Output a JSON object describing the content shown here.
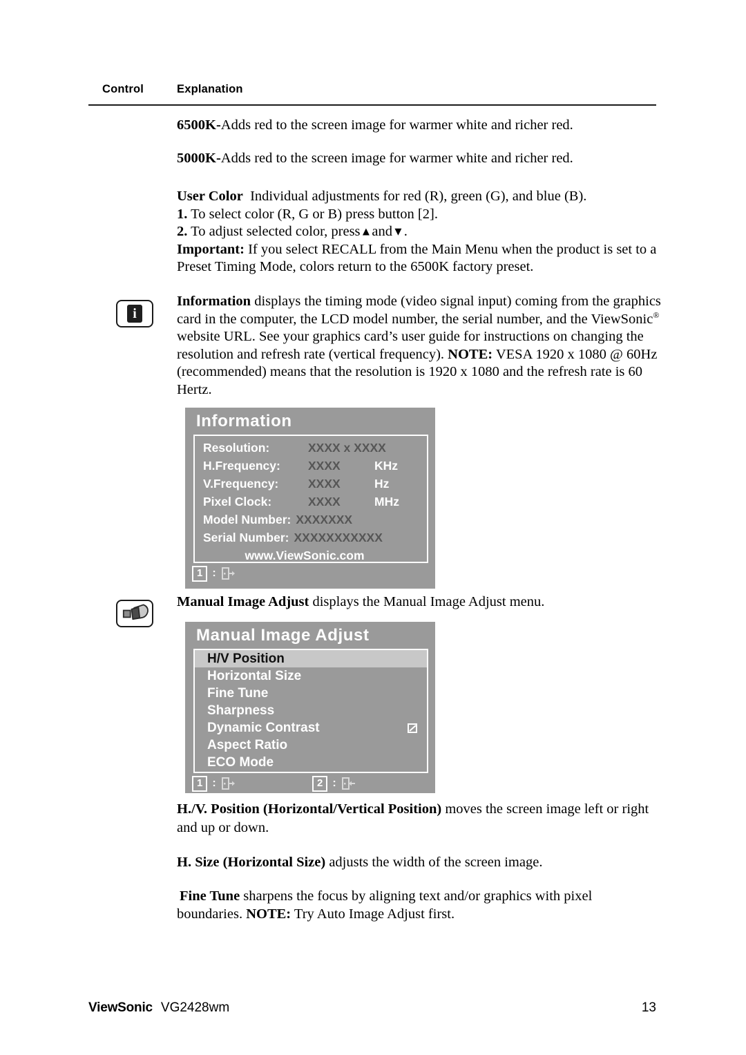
{
  "header": {
    "col_control": "Control",
    "col_explanation": "Explanation"
  },
  "content": {
    "p6500k_bold": "6500K-",
    "p6500k_rest": "Adds red to the screen image for warmer white and richer red.",
    "p5000k_bold": "5000K-",
    "p5000k_rest": "Adds red to the screen image for warmer white and richer red.",
    "usercolor_bold": "User Color",
    "usercolor_rest": "Individual adjustments for red (R), green (G),  and blue (B).",
    "usercolor_step1_num": "1.",
    "usercolor_step1_text": "To select color (R, G or B) press button [2].",
    "usercolor_step2_num": "2.",
    "usercolor_step2_text_a": "To adjust selected color, press",
    "usercolor_step2_up": "▲",
    "usercolor_step2_text_b": "and",
    "usercolor_step2_down": "▼",
    "usercolor_step2_text_c": ".",
    "usercolor_important_bold": "Important:",
    "usercolor_important_rest": "If you select RECALL from the Main Menu when the product is set to a Preset Timing Mode, colors return to the 6500K factory preset.",
    "information_bold": "Information",
    "information_rest_a": "displays the timing mode (video signal input) coming from the graphics card in the computer, the LCD model number, the serial number, and the ViewSonic",
    "information_reg": "®",
    "information_rest_b": "website URL. See your graphics card’s user guide for instructions on changing the resolution and refresh rate (vertical frequency).",
    "information_note_bold": "NOTE:",
    "information_note_rest": "VESA 1920 x 1080 @ 60Hz (recommended) means that the resolution is 1920 x 1080 and the refresh rate is 60 Hertz.",
    "manual_intro_bold": "Manual Image Adjust",
    "manual_intro_rest": "displays the Manual Image Adjust menu.",
    "hv_bold": "H./V. Position (Horizontal/Vertical Position)",
    "hv_rest": "moves the screen image left or right and up or down.",
    "hsize_bold": "H. Size (Horizontal Size)",
    "hsize_rest": "adjusts the width of the screen image.",
    "finetune_bold": "Fine Tune",
    "finetune_rest": "sharpens the focus by aligning text and/or graphics with pixel boundaries.",
    "finetune_note_bold": "NOTE:",
    "finetune_note_rest": "Try Auto Image Adjust first."
  },
  "icons": {
    "info_glyph": "i"
  },
  "osd_information": {
    "title": "Information",
    "rows": [
      {
        "label": "Resolution:",
        "value": "XXXX x XXXX",
        "unit": ""
      },
      {
        "label": "H.Frequency:",
        "value": "XXXX",
        "unit": "KHz"
      },
      {
        "label": "V.Frequency:",
        "value": "XXXX",
        "unit": "Hz"
      },
      {
        "label": "Pixel Clock:",
        "value": "XXXX",
        "unit": "MHz"
      },
      {
        "label": "Model Number:",
        "value": "XXXXXXX",
        "unit": ""
      },
      {
        "label": "Serial Number:",
        "value": "XXXXXXXXXXX",
        "unit": ""
      }
    ],
    "url": "www.ViewSonic.com",
    "footer_key": "1",
    "footer_colon": ":"
  },
  "osd_manual": {
    "title": "Manual Image Adjust",
    "items": [
      {
        "label": "H/V Position",
        "selected": true,
        "checkbox": false
      },
      {
        "label": "Horizontal Size",
        "selected": false,
        "checkbox": false
      },
      {
        "label": "Fine Tune",
        "selected": false,
        "checkbox": false
      },
      {
        "label": "Sharpness",
        "selected": false,
        "checkbox": false
      },
      {
        "label": "Dynamic Contrast",
        "selected": false,
        "checkbox": true
      },
      {
        "label": "Aspect Ratio",
        "selected": false,
        "checkbox": false
      },
      {
        "label": "ECO Mode",
        "selected": false,
        "checkbox": false
      }
    ],
    "footer_key_exit": "1",
    "footer_key_enter": "2",
    "footer_colon": ":"
  },
  "footer": {
    "brand": "ViewSonic",
    "model": "VG2428wm",
    "page_number": "13"
  },
  "colors": {
    "osd_background": "#9a9a9a",
    "osd_highlight": "#c8c8c8",
    "osd_value_text": "#565656",
    "text": "#000000"
  }
}
